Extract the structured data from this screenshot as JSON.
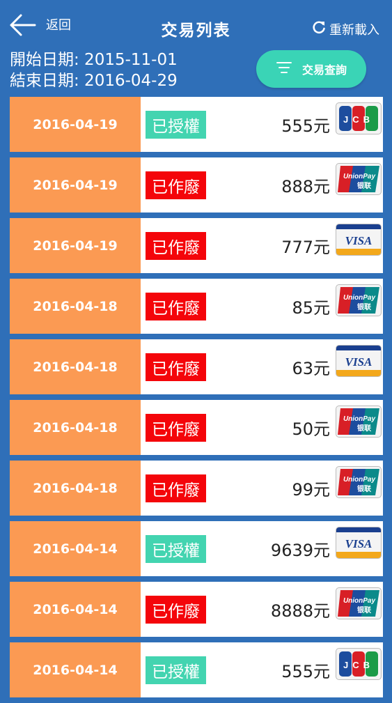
{
  "header": {
    "back_label": "返回",
    "title": "交易列表",
    "reload_label": "重新載入",
    "start_date": "開始日期: 2015-11-01",
    "end_date": "結束日期: 2016-04-29",
    "query_label": "交易查詢"
  },
  "transactions": [
    {
      "date": "2016-04-19",
      "status": "已授權",
      "status_type": "auth",
      "amount": "555元",
      "card": "jcb"
    },
    {
      "date": "2016-04-19",
      "status": "已作廢",
      "status_type": "void",
      "amount": "888元",
      "card": "unionpay"
    },
    {
      "date": "2016-04-19",
      "status": "已作廢",
      "status_type": "void",
      "amount": "777元",
      "card": "visa"
    },
    {
      "date": "2016-04-18",
      "status": "已作廢",
      "status_type": "void",
      "amount": "85元",
      "card": "unionpay"
    },
    {
      "date": "2016-04-18",
      "status": "已作廢",
      "status_type": "void",
      "amount": "63元",
      "card": "visa"
    },
    {
      "date": "2016-04-18",
      "status": "已作廢",
      "status_type": "void",
      "amount": "50元",
      "card": "unionpay"
    },
    {
      "date": "2016-04-18",
      "status": "已作廢",
      "status_type": "void",
      "amount": "99元",
      "card": "unionpay"
    },
    {
      "date": "2016-04-14",
      "status": "已授權",
      "status_type": "auth",
      "amount": "9639元",
      "card": "visa"
    },
    {
      "date": "2016-04-14",
      "status": "已作廢",
      "status_type": "void",
      "amount": "8888元",
      "card": "unionpay"
    },
    {
      "date": "2016-04-14",
      "status": "已授權",
      "status_type": "auth",
      "amount": "555元",
      "card": "jcb"
    }
  ],
  "cards": {
    "jcb": {
      "text": "JCB"
    },
    "visa": {
      "text": "VISA"
    },
    "unionpay": {
      "text": "UnionPay",
      "sub": "银联"
    }
  },
  "colors": {
    "background": "#2f6fb8",
    "date_cell": "#fb9a53",
    "void": "#f4050a",
    "authorized": "#43d4b0",
    "query_button": "#3ad4b6"
  }
}
